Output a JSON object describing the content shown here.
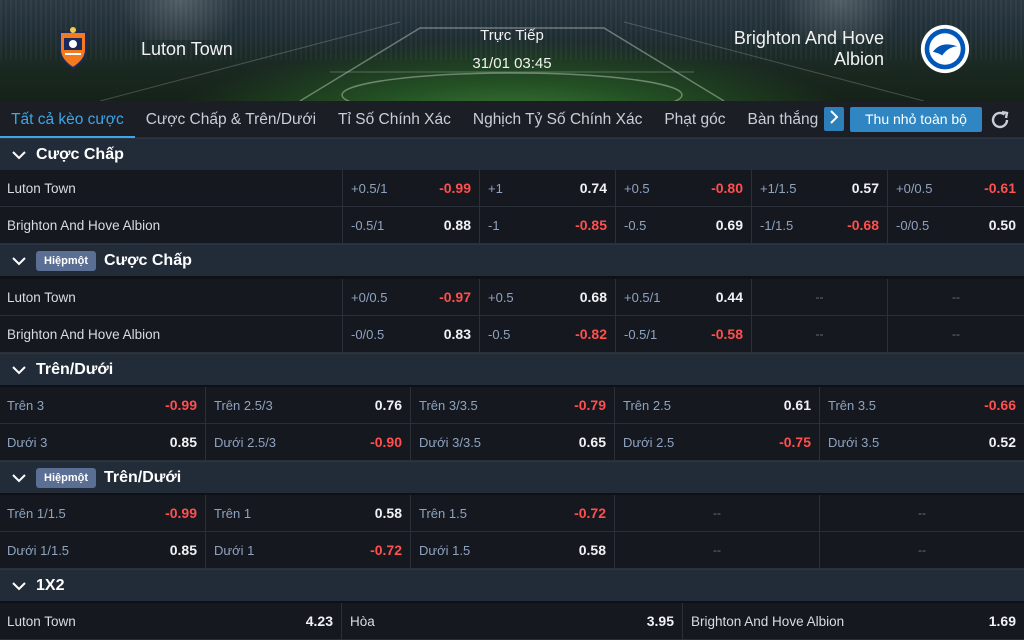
{
  "match": {
    "home": "Luton Town",
    "away_line1": "Brighton And Hove",
    "away_line2": "Albion",
    "status": "Trực Tiếp",
    "datetime": "31/01 03:45"
  },
  "tabs": [
    "Tất cả kèo cược",
    "Cược Chấp & Trên/Dưới",
    "Tỉ Số Chính Xác",
    "Nghịch Tỷ Số Chính Xác",
    "Phạt góc",
    "Bàn thắng"
  ],
  "toolbar": {
    "collapse_label": "Thu nhỏ toàn bộ",
    "next_icon": "chevron-right-icon",
    "refresh_icon": "refresh-icon"
  },
  "badge": "Hiệpmột",
  "sections": {
    "handicap": {
      "title": "Cược Chấp",
      "rows": [
        {
          "team": "Luton Town",
          "cells": [
            [
              "+0.5/1",
              "-0.99"
            ],
            [
              "+1",
              "0.74"
            ],
            [
              "+0.5",
              "-0.80"
            ],
            [
              "+1/1.5",
              "0.57"
            ],
            [
              "+0/0.5",
              "-0.61"
            ]
          ]
        },
        {
          "team": "Brighton And Hove Albion",
          "cells": [
            [
              "-0.5/1",
              "0.88"
            ],
            [
              "-1",
              "-0.85"
            ],
            [
              "-0.5",
              "0.69"
            ],
            [
              "-1/1.5",
              "-0.68"
            ],
            [
              "-0/0.5",
              "0.50"
            ]
          ]
        }
      ]
    },
    "handicap_half": {
      "title": "Cược Chấp",
      "rows": [
        {
          "team": "Luton Town",
          "cells": [
            [
              "+0/0.5",
              "-0.97"
            ],
            [
              "+0.5",
              "0.68"
            ],
            [
              "+0.5/1",
              "0.44"
            ],
            [
              "--",
              ""
            ],
            [
              "--",
              ""
            ]
          ]
        },
        {
          "team": "Brighton And Hove Albion",
          "cells": [
            [
              "-0/0.5",
              "0.83"
            ],
            [
              "-0.5",
              "-0.82"
            ],
            [
              "-0.5/1",
              "-0.58"
            ],
            [
              "--",
              ""
            ],
            [
              "--",
              ""
            ]
          ]
        }
      ]
    },
    "ou": {
      "title": "Trên/Dưới",
      "rows": [
        {
          "cells": [
            [
              "Trên 3",
              "-0.99"
            ],
            [
              "Trên 2.5/3",
              "0.76"
            ],
            [
              "Trên 3/3.5",
              "-0.79"
            ],
            [
              "Trên 2.5",
              "0.61"
            ],
            [
              "Trên 3.5",
              "-0.66"
            ]
          ]
        },
        {
          "cells": [
            [
              "Dưới 3",
              "0.85"
            ],
            [
              "Dưới 2.5/3",
              "-0.90"
            ],
            [
              "Dưới 3/3.5",
              "0.65"
            ],
            [
              "Dưới 2.5",
              "-0.75"
            ],
            [
              "Dưới 3.5",
              "0.52"
            ]
          ]
        }
      ]
    },
    "ou_half": {
      "title": "Trên/Dưới",
      "rows": [
        {
          "cells": [
            [
              "Trên 1/1.5",
              "-0.99"
            ],
            [
              "Trên 1",
              "0.58"
            ],
            [
              "Trên 1.5",
              "-0.72"
            ],
            [
              "--",
              ""
            ],
            [
              "--",
              ""
            ]
          ]
        },
        {
          "cells": [
            [
              "Dưới 1/1.5",
              "0.85"
            ],
            [
              "Dưới 1",
              "-0.72"
            ],
            [
              "Dưới 1.5",
              "0.58"
            ],
            [
              "--",
              ""
            ],
            [
              "--",
              ""
            ]
          ]
        }
      ]
    },
    "x12": {
      "title": "1X2",
      "cells": [
        [
          "Luton Town",
          "4.23"
        ],
        [
          "Hòa",
          "3.95"
        ],
        [
          "Brighton And Hove Albion",
          "1.69"
        ]
      ]
    }
  }
}
